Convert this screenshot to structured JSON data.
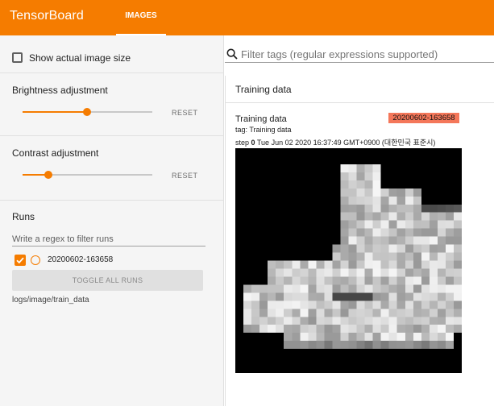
{
  "header": {
    "brand": "TensorBoard",
    "tabs": [
      {
        "label": "IMAGES",
        "active": true
      }
    ]
  },
  "sidebar": {
    "show_actual_size": {
      "label": "Show actual image size",
      "checked": false
    },
    "brightness": {
      "label": "Brightness adjustment",
      "value": 0.75,
      "reset_label": "RESET"
    },
    "contrast": {
      "label": "Contrast adjustment",
      "value": 0.2,
      "reset_label": "RESET"
    },
    "runs": {
      "title": "Runs",
      "filter_placeholder": "Write a regex to filter runs",
      "items": [
        {
          "name": "20200602-163658",
          "checked": true
        }
      ],
      "toggle_label": "TOGGLE ALL RUNS",
      "logdir": "logs/image/train_data"
    }
  },
  "main": {
    "filter_placeholder": "Filter tags (regular expressions supported)",
    "card": {
      "title": "Training data",
      "image": {
        "title": "Training data",
        "run": "20200602-163658",
        "tag_label": "tag: Training data",
        "step_prefix": "step",
        "step": "0",
        "timestamp": "Tue Jun 02 2020 16:37:49 GMT+0900 (대한민국 표준시)"
      }
    }
  },
  "colors": {
    "accent": "#f57c00",
    "run_badge": "#f4775a",
    "sidebar_bg": "#f5f5f5"
  }
}
